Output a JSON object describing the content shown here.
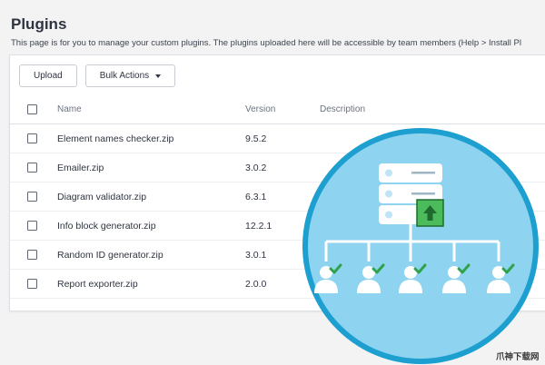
{
  "page": {
    "title": "Plugins",
    "subtitle": "This page is for you to manage your custom plugins. The plugins uploaded here will be accessible by team members (Help > Install Pl"
  },
  "toolbar": {
    "upload_label": "Upload",
    "bulk_actions_label": "Bulk Actions"
  },
  "table": {
    "headers": {
      "name": "Name",
      "version": "Version",
      "description": "Description"
    },
    "rows": [
      {
        "name": "Element names checker.zip",
        "version": "9.5.2",
        "description": ""
      },
      {
        "name": "Emailer.zip",
        "version": "3.0.2",
        "description": ""
      },
      {
        "name": "Diagram validator.zip",
        "version": "6.3.1",
        "description": ""
      },
      {
        "name": "Info block generator.zip",
        "version": "12.2.1",
        "description": ""
      },
      {
        "name": "Random ID generator.zip",
        "version": "3.0.1",
        "description": ""
      },
      {
        "name": "Report exporter.zip",
        "version": "2.0.0",
        "description": ""
      }
    ]
  },
  "illustration": {
    "icons": [
      "server-icon",
      "upload-arrow-icon",
      "user-icon",
      "checkmark-icon"
    ],
    "colors": {
      "circle_fill": "#8ed3ef",
      "circle_ring": "#1d9fd0",
      "check_green": "#2fa34b",
      "upload_green": "#4cbb5c"
    }
  },
  "watermark": {
    "text": "爪神下载网"
  }
}
